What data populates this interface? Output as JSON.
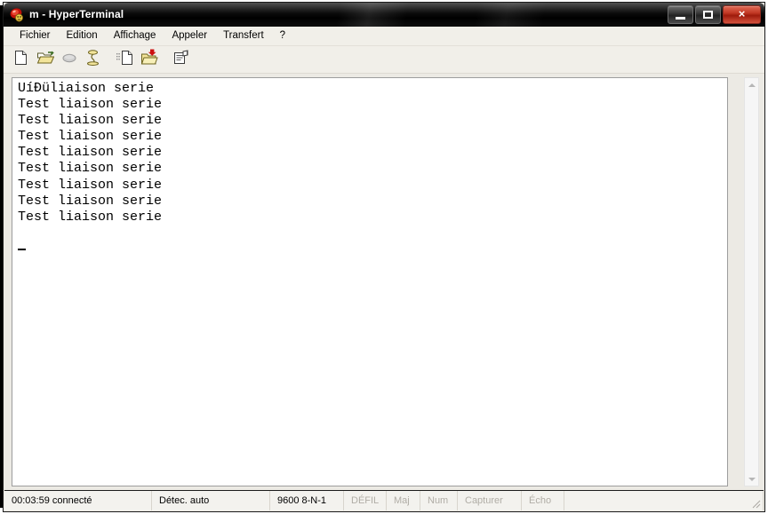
{
  "window": {
    "title": "m - HyperTerminal",
    "icon": "hyperterminal-icon",
    "controls": {
      "minimize": "minimize-button",
      "maximize": "maximize-button",
      "close": "×"
    }
  },
  "menubar": {
    "items": [
      {
        "label": "Fichier",
        "name": "menu-fichier"
      },
      {
        "label": "Edition",
        "name": "menu-edition"
      },
      {
        "label": "Affichage",
        "name": "menu-affichage"
      },
      {
        "label": "Appeler",
        "name": "menu-appeler"
      },
      {
        "label": "Transfert",
        "name": "menu-transfert"
      },
      {
        "label": "?",
        "name": "menu-help"
      }
    ]
  },
  "toolbar": {
    "buttons": [
      {
        "name": "new-connection-icon",
        "tooltip": "Nouvelle connexion"
      },
      {
        "name": "open-folder-icon",
        "tooltip": "Ouvrir"
      },
      {
        "name": "call-phone-icon",
        "tooltip": "Appeler"
      },
      {
        "name": "hangup-phone-icon",
        "tooltip": "Déconnecter"
      },
      {
        "name": "send-file-icon",
        "tooltip": "Envoyer"
      },
      {
        "name": "receive-file-icon",
        "tooltip": "Recevoir"
      },
      {
        "name": "properties-icon",
        "tooltip": "Propriétés"
      }
    ]
  },
  "terminal": {
    "lines": [
      "UíÐüliaison serie",
      "Test liaison serie",
      "Test liaison serie",
      "Test liaison serie",
      "Test liaison serie",
      "Test liaison serie",
      "Test liaison serie",
      "Test liaison serie",
      "Test liaison serie"
    ],
    "cursor_visible": true,
    "foreground": "#000000",
    "background": "#ffffff"
  },
  "scrollbar": {
    "up_arrow": "scroll-up-arrow",
    "down_arrow": "scroll-down-arrow"
  },
  "statusbar": {
    "connection_time": "00:03:59 connecté",
    "detection": "Détec. auto",
    "port_settings": "9600 8-N-1",
    "indicators": [
      {
        "label": "DÉFIL",
        "name": "status-defil",
        "active": false
      },
      {
        "label": "Maj",
        "name": "status-maj",
        "active": false
      },
      {
        "label": "Num",
        "name": "status-num",
        "active": false
      },
      {
        "label": "Capturer",
        "name": "status-capturer",
        "active": false
      },
      {
        "label": "Écho",
        "name": "status-echo",
        "active": false
      }
    ]
  }
}
